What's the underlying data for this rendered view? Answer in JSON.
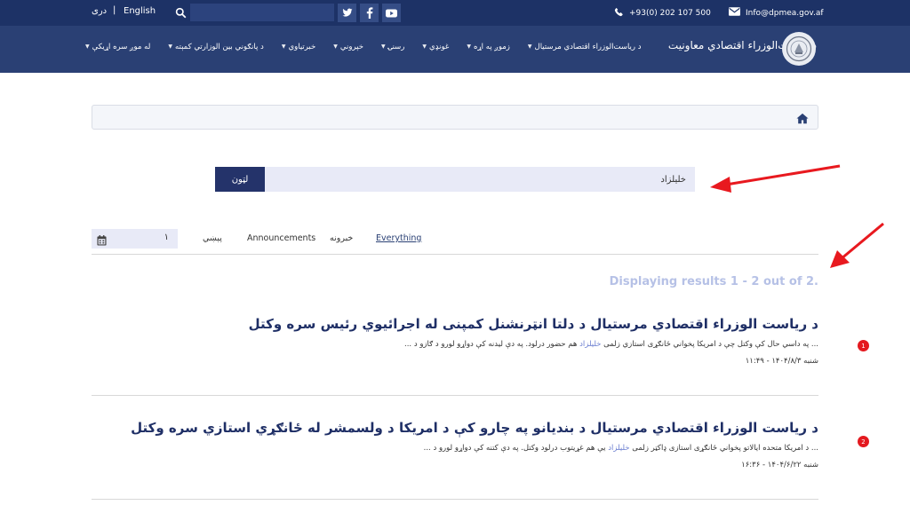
{
  "topbar": {
    "lang_dari": "دری",
    "lang_sep": "|",
    "lang_english": "English",
    "search_placeholder": "",
    "phone": "+93(0) 202 107 500",
    "email": "Info@dpmea.gov.af"
  },
  "nav": {
    "brand": "د رياست‌الوزراء اقتصادي معاونيت",
    "items": [
      "له موږ سره اړيکې",
      "د پانګوني بين الوزارتي کمېته",
      "خبرتیاوي",
      "خپروني",
      "رسنۍ",
      "غونډي",
      "زموږ په اړه",
      "د رياست‌الوزراء اقتصادي مرستيال"
    ]
  },
  "search": {
    "query": "خلیلزاد",
    "button_label": "لټون"
  },
  "filters": {
    "date_value": "۱",
    "tabs": [
      "پېښي",
      "Announcements",
      "خبرونه",
      "Everything"
    ],
    "active_tab": "Everything"
  },
  "results_count": "Displaying results 1 - 2 out of 2.",
  "results": [
    {
      "number": "1",
      "title": "د رياست الوزراء اقتصادي مرستيال د دلتا انټرنشنل کمپنی له اجرائيوي رئيس سره وکتل",
      "snippet_before": "... په داسي حال کې وکتل چې د امريکا پخواني ځانګړی استازي زلمی ",
      "snippet_highlight": "خلیلزاد",
      "snippet_after": " هم حضور درلود.  په دې ليدنه کې دواړو لورو د ګازو د ...",
      "date": "شنبه ۱۴۰۴/۸/۳ - ۱۱:۴۹"
    },
    {
      "number": "2",
      "title": "د رياست الوزراء اقتصادي مرستيال د بنديانو په چارو کې د امريکا د ولسمشر له ځانګړي استازي سره وکتل",
      "snippet_before": "... د امريکا متحده ايالاتو پخواني ځانګړی استازی ډاکټر زلمی ",
      "snippet_highlight": "خلیلزاد",
      "snippet_after": " یې هم غړیتوب درلود وکتل.  په دې کتنه کې دواړو لورو د ...",
      "date": "شنبه ۱۴۰۴/۶/۲۲ - ۱۶:۳۶"
    }
  ],
  "colors": {
    "topbar": "#1d3266",
    "navbar": "#2a4074",
    "accent": "#24336a",
    "badge": "#e4191f",
    "annotation_arrow": "#e8191f"
  }
}
